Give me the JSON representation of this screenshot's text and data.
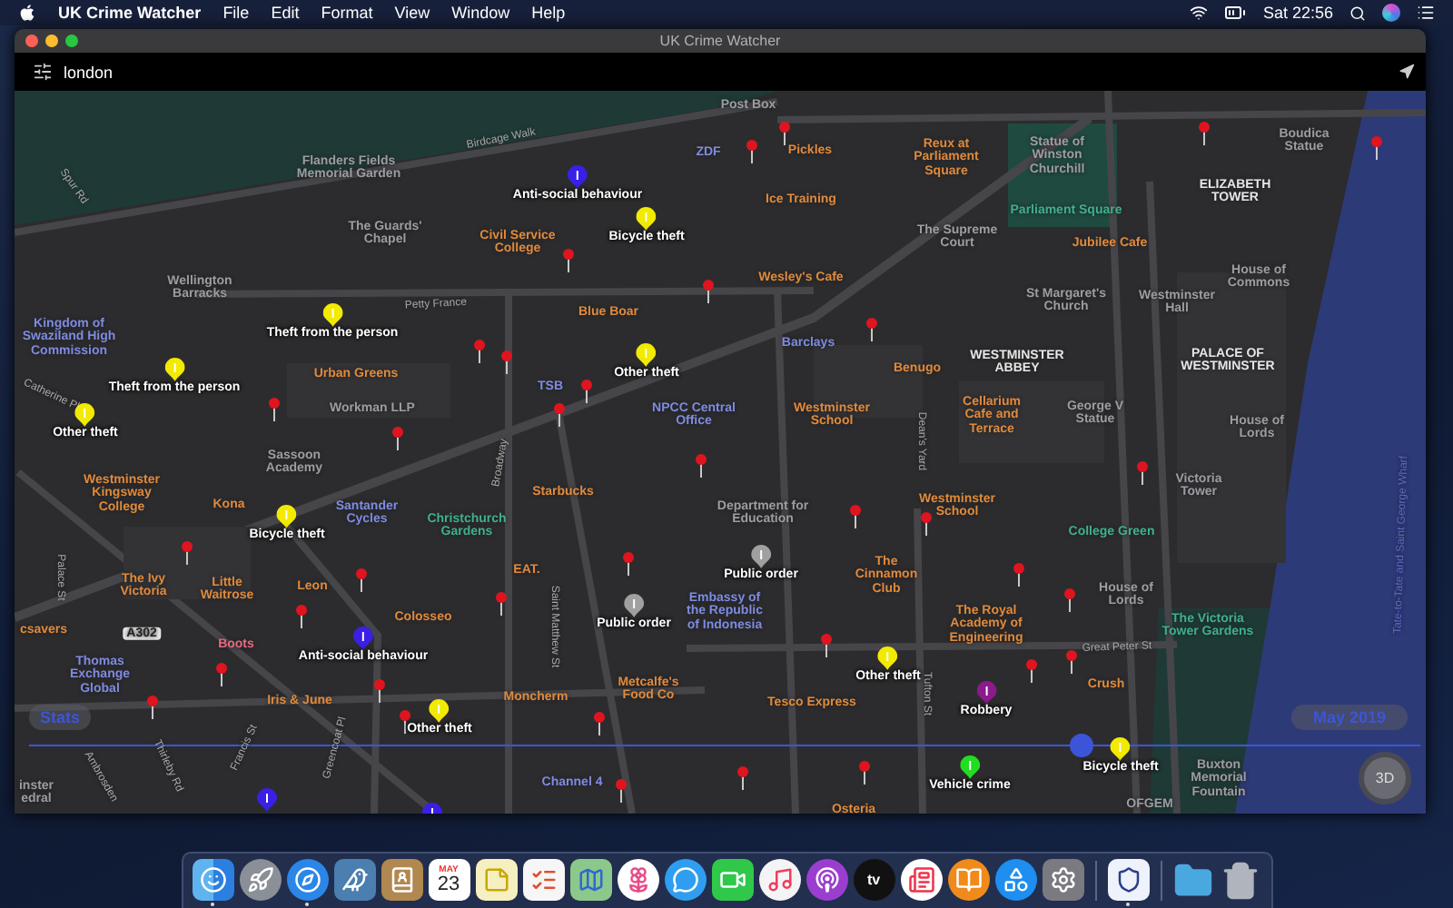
{
  "menubar": {
    "app_name": "UK Crime Watcher",
    "menus": [
      "File",
      "Edit",
      "Format",
      "View",
      "Window",
      "Help"
    ],
    "clock": "Sat 22:56"
  },
  "window": {
    "title": "UK Crime Watcher"
  },
  "search": {
    "value": "london"
  },
  "map": {
    "places": [
      {
        "kind": "landmark",
        "name": "Flanders Fields Memorial Garden"
      },
      {
        "kind": "street",
        "name": "Birdcage Walk"
      },
      {
        "kind": "street",
        "name": "Spur Rd"
      },
      {
        "kind": "landmark",
        "name": "The Guards' Chapel"
      },
      {
        "kind": "poi",
        "name": "Civil Service College"
      },
      {
        "kind": "landmark",
        "name": "Wellington Barracks"
      },
      {
        "kind": "street",
        "name": "Petty France"
      },
      {
        "kind": "blue",
        "name": "Kingdom of Swaziland High Commission"
      },
      {
        "kind": "poi",
        "name": "Blue Boar"
      },
      {
        "kind": "poi",
        "name": "Urban Greens"
      },
      {
        "kind": "blue",
        "name": "TSB"
      },
      {
        "kind": "landmark",
        "name": "Workman LLP"
      },
      {
        "kind": "blue",
        "name": "NPCC Central Office"
      },
      {
        "kind": "street",
        "name": "Catherine Pl"
      },
      {
        "kind": "landmark",
        "name": "Sassoon Academy"
      },
      {
        "kind": "blue",
        "name": "ZDF"
      },
      {
        "kind": "landmark",
        "name": "Post Box"
      },
      {
        "kind": "poi",
        "name": "Pickles"
      },
      {
        "kind": "poi",
        "name": "Ice Training"
      },
      {
        "kind": "poi",
        "name": "Reux at Parliament Square"
      },
      {
        "kind": "landmark",
        "name": "Statue of Winston Churchill"
      },
      {
        "kind": "green",
        "name": "Parliament Square"
      },
      {
        "kind": "landmark",
        "name": "The Supreme Court"
      },
      {
        "kind": "poi",
        "name": "Jubilee Cafe"
      },
      {
        "kind": "building",
        "name": "ELIZABETH TOWER"
      },
      {
        "kind": "landmark",
        "name": "Boudica Statue"
      },
      {
        "kind": "poi",
        "name": "Wesley's Cafe"
      },
      {
        "kind": "landmark",
        "name": "House of Commons"
      },
      {
        "kind": "landmark",
        "name": "St Margaret's Church"
      },
      {
        "kind": "landmark",
        "name": "Westminster Hall"
      },
      {
        "kind": "blue",
        "name": "Barclays"
      },
      {
        "kind": "poi",
        "name": "Benugo"
      },
      {
        "kind": "building",
        "name": "WESTMINSTER ABBEY"
      },
      {
        "kind": "building",
        "name": "PALACE OF WESTMINSTER"
      },
      {
        "kind": "poi",
        "name": "Westminster School"
      },
      {
        "kind": "poi",
        "name": "Cellarium Cafe and Terrace"
      },
      {
        "kind": "landmark",
        "name": "George V Statue"
      },
      {
        "kind": "landmark",
        "name": "House of Lords"
      },
      {
        "kind": "street",
        "name": "Dean's Yard"
      },
      {
        "kind": "poi",
        "name": "Westminster Kingsway College"
      },
      {
        "kind": "poi",
        "name": "Kona"
      },
      {
        "kind": "blue",
        "name": "Santander Cycles"
      },
      {
        "kind": "green",
        "name": "Christchurch Gardens"
      },
      {
        "kind": "poi",
        "name": "Starbucks"
      },
      {
        "kind": "landmark",
        "name": "Victoria Tower"
      },
      {
        "kind": "poi",
        "name": "Westminster School"
      },
      {
        "kind": "landmark",
        "name": "Department for Education"
      },
      {
        "kind": "green",
        "name": "College Green"
      },
      {
        "kind": "poi",
        "name": "The Ivy Victoria"
      },
      {
        "kind": "poi",
        "name": "Little Waitrose"
      },
      {
        "kind": "poi",
        "name": "Leon"
      },
      {
        "kind": "poi",
        "name": "EAT."
      },
      {
        "kind": "poi",
        "name": "csavers"
      },
      {
        "kind": "road",
        "name": "A302"
      },
      {
        "kind": "poi",
        "name": "Colosseo"
      },
      {
        "kind": "poi",
        "name": "The Cinnamon Club"
      },
      {
        "kind": "blue",
        "name": "Embassy of the Republic of Indonesia"
      },
      {
        "kind": "landmark",
        "name": "House of Lords"
      },
      {
        "kind": "poi",
        "name": "The Royal Academy of Engineering"
      },
      {
        "kind": "green",
        "name": "The Victoria Tower Gardens"
      },
      {
        "kind": "street",
        "name": "Palace St"
      },
      {
        "kind": "street",
        "name": "Saint Matthew St"
      },
      {
        "kind": "pink",
        "name": "Boots"
      },
      {
        "kind": "blue",
        "name": "Thomas Exchange Global"
      },
      {
        "kind": "street",
        "name": "Great Peter St"
      },
      {
        "kind": "poi",
        "name": "Crush"
      },
      {
        "kind": "poi",
        "name": "Iris & June"
      },
      {
        "kind": "poi",
        "name": "Moncherm"
      },
      {
        "kind": "poi",
        "name": "Metcalfe's Food Co"
      },
      {
        "kind": "poi",
        "name": "Tesco Express"
      },
      {
        "kind": "street",
        "name": "Tufton St"
      },
      {
        "kind": "street",
        "name": "Thirleby Rd"
      },
      {
        "kind": "street",
        "name": "Francis St"
      },
      {
        "kind": "street",
        "name": "Greencoat Pl"
      },
      {
        "kind": "blue",
        "name": "Channel 4"
      },
      {
        "kind": "landmark",
        "name": "Buxton Memorial Fountain"
      },
      {
        "kind": "landmark",
        "name": "OFGEM"
      },
      {
        "kind": "poi",
        "name": "Osteria"
      },
      {
        "kind": "landmark",
        "name": "inster edral"
      },
      {
        "kind": "street",
        "name": "Ambrosden"
      },
      {
        "kind": "street",
        "name": "Broadway"
      },
      {
        "kind": "river",
        "name": "Tate-to-Tate and Saint George Wharf"
      }
    ],
    "crimes": [
      {
        "label": "Anti-social behaviour",
        "color": "#3a1fe6"
      },
      {
        "label": "Bicycle theft",
        "color": "#f2ea00"
      },
      {
        "label": "Theft from the person",
        "color": "#f2ea00"
      },
      {
        "label": "Theft from the person",
        "color": "#f2ea00"
      },
      {
        "label": "Other theft",
        "color": "#f2ea00"
      },
      {
        "label": "Other theft",
        "color": "#f2ea00"
      },
      {
        "label": "Bicycle theft",
        "color": "#f2ea00"
      },
      {
        "label": "Public order",
        "color": "#a0a0a0"
      },
      {
        "label": "Public order",
        "color": "#a0a0a0"
      },
      {
        "label": "Anti-social behaviour",
        "color": "#3a1fe6"
      },
      {
        "label": "Other theft",
        "color": "#f2ea00"
      },
      {
        "label": "Robbery",
        "color": "#8c1a8c"
      },
      {
        "label": "Other theft",
        "color": "#f2ea00"
      },
      {
        "label": "Vehicle crime",
        "color": "#22dd22"
      },
      {
        "label": "Bicycle theft",
        "color": "#f2ea00"
      },
      {
        "color": "#3a1fe6"
      },
      {
        "color": "#3a1fe6"
      }
    ]
  },
  "timeline": {
    "level": 0.756,
    "stats_button": "Stats",
    "period": "May 2019",
    "view_button": "3D"
  },
  "dock": {
    "items": [
      {
        "kind": "finder",
        "running": true
      },
      {
        "kind": "launchpad",
        "running": false
      },
      {
        "kind": "safari",
        "running": true
      },
      {
        "kind": "preview",
        "running": false
      },
      {
        "kind": "contacts",
        "running": false
      },
      {
        "kind": "calendar",
        "running": false,
        "month": "MAY",
        "day": "23"
      },
      {
        "kind": "notes",
        "running": false
      },
      {
        "kind": "reminders",
        "running": false
      },
      {
        "kind": "maps",
        "running": false
      },
      {
        "kind": "photos",
        "running": false
      },
      {
        "kind": "messages",
        "running": false
      },
      {
        "kind": "facetime",
        "running": false
      },
      {
        "kind": "music",
        "running": false
      },
      {
        "kind": "podcasts",
        "running": false
      },
      {
        "kind": "tv",
        "running": false,
        "label": "tv"
      },
      {
        "kind": "news",
        "running": false
      },
      {
        "kind": "books",
        "running": false
      },
      {
        "kind": "appstore",
        "running": false
      },
      {
        "kind": "settings",
        "running": false
      },
      {
        "kind": "separator"
      },
      {
        "kind": "crimewatcher",
        "running": true
      },
      {
        "kind": "separator"
      },
      {
        "kind": "folder",
        "running": false
      },
      {
        "kind": "trash",
        "running": false
      }
    ]
  }
}
